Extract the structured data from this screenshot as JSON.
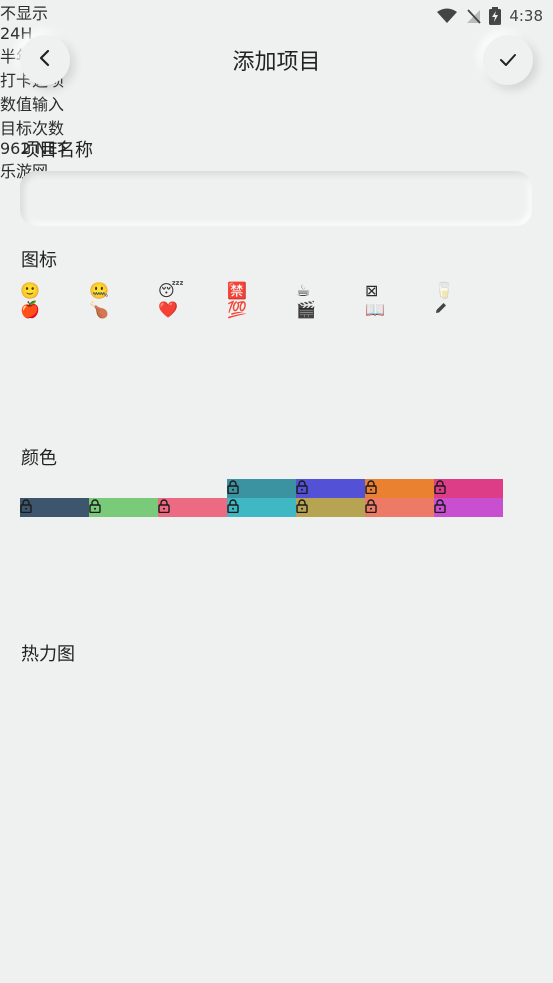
{
  "status_bar": {
    "time": "4:38"
  },
  "header": {
    "title": "添加项目"
  },
  "name_section": {
    "label": "项目名称",
    "placeholder": ""
  },
  "icon_section": {
    "label": "图标",
    "icons": [
      "🙂",
      "🤐",
      "😴",
      "🈲",
      "☕",
      "⊠",
      "🥛",
      "🍎",
      "🍗",
      "❤️",
      "💯",
      "🎬",
      "📖"
    ],
    "edit_icon": "pencil-icon"
  },
  "color_section": {
    "label": "颜色",
    "colors": [
      {
        "hex": "#4f6f9c",
        "locked": false
      },
      {
        "hex": "#4a9e5a",
        "locked": false
      },
      {
        "hex": "#d34a4a",
        "locked": false
      },
      {
        "hex": "#3b93a2",
        "locked": true
      },
      {
        "hex": "#5351d6",
        "locked": true
      },
      {
        "hex": "#ea8131",
        "locked": true
      },
      {
        "hex": "#dd3c87",
        "locked": true
      },
      {
        "hex": "#3e566d",
        "locked": true
      },
      {
        "hex": "#79cb7a",
        "locked": true
      },
      {
        "hex": "#ec6a82",
        "locked": true
      },
      {
        "hex": "#3fb8c4",
        "locked": true
      },
      {
        "hex": "#b7a453",
        "locked": true
      },
      {
        "hex": "#ec7a66",
        "locked": true
      },
      {
        "hex": "#c84fcf",
        "locked": true
      }
    ]
  },
  "heatmap_section": {
    "label": "热力图",
    "options": [
      "不显示",
      "24H",
      "半年视图"
    ],
    "selected": 0
  },
  "toggles": [
    {
      "label": "打卡选项",
      "on": false
    },
    {
      "label": "数值输入",
      "on": false
    },
    {
      "label": "目标次数",
      "on": false
    }
  ],
  "watermark": {
    "brand": "962",
    "suffix": ".NET",
    "sub": "乐游网"
  }
}
